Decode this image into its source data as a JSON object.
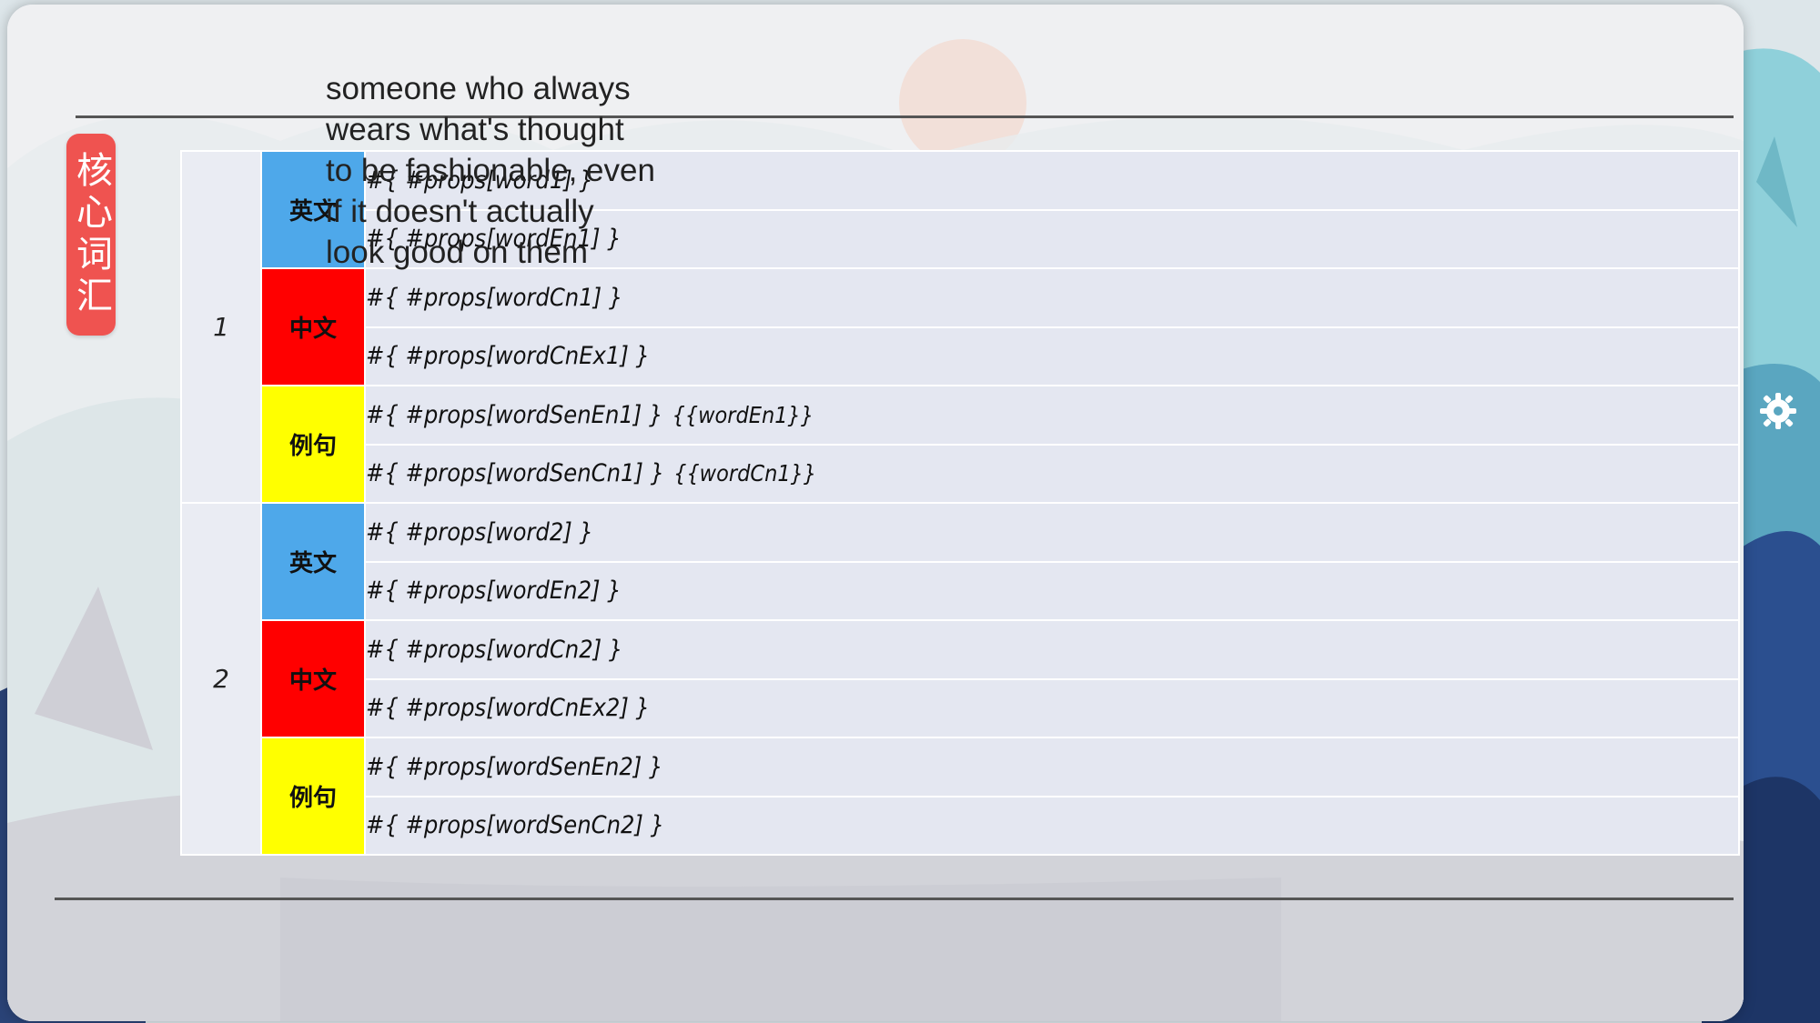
{
  "badge": {
    "text": "核心词汇"
  },
  "overlay_text": "someone who always\nwears what's thought\nto be fashionable, even\nif it doesn't actually\nlook good on them",
  "groups": [
    {
      "number": "1",
      "rows": [
        {
          "category": "英文",
          "lines": [
            {
              "text": "#{ #props[word1] }"
            },
            {
              "text": "#{ #props[wordEn1] }"
            }
          ]
        },
        {
          "category": "中文",
          "lines": [
            {
              "text": "#{ #props[wordCn1] }"
            },
            {
              "text": "#{ #props[wordCnEx1] }"
            }
          ]
        },
        {
          "category": "例句",
          "lines": [
            {
              "text": "#{ #props[wordSenEn1] }",
              "tag": "{{wordEn1}}"
            },
            {
              "text": "#{ #props[wordSenCn1] }",
              "tag": "{{wordCn1}}"
            }
          ]
        }
      ]
    },
    {
      "number": "2",
      "rows": [
        {
          "category": "英文",
          "lines": [
            {
              "text": "#{ #props[word2] }"
            },
            {
              "text": "#{ #props[wordEn2] }"
            }
          ]
        },
        {
          "category": "中文",
          "lines": [
            {
              "text": "#{ #props[wordCn2] }"
            },
            {
              "text": "#{ #props[wordCnEx2] }"
            }
          ]
        },
        {
          "category": "例句",
          "lines": [
            {
              "text": "#{ #props[wordSenEn2] }"
            },
            {
              "text": "#{ #props[wordSenCn2] }"
            }
          ]
        }
      ]
    }
  ],
  "colors": {
    "english": "#4ea8ea",
    "chinese": "#ff0000",
    "example": "#ffff00",
    "badge": "#ef5350"
  },
  "icons": {
    "settings": "gear-icon"
  }
}
